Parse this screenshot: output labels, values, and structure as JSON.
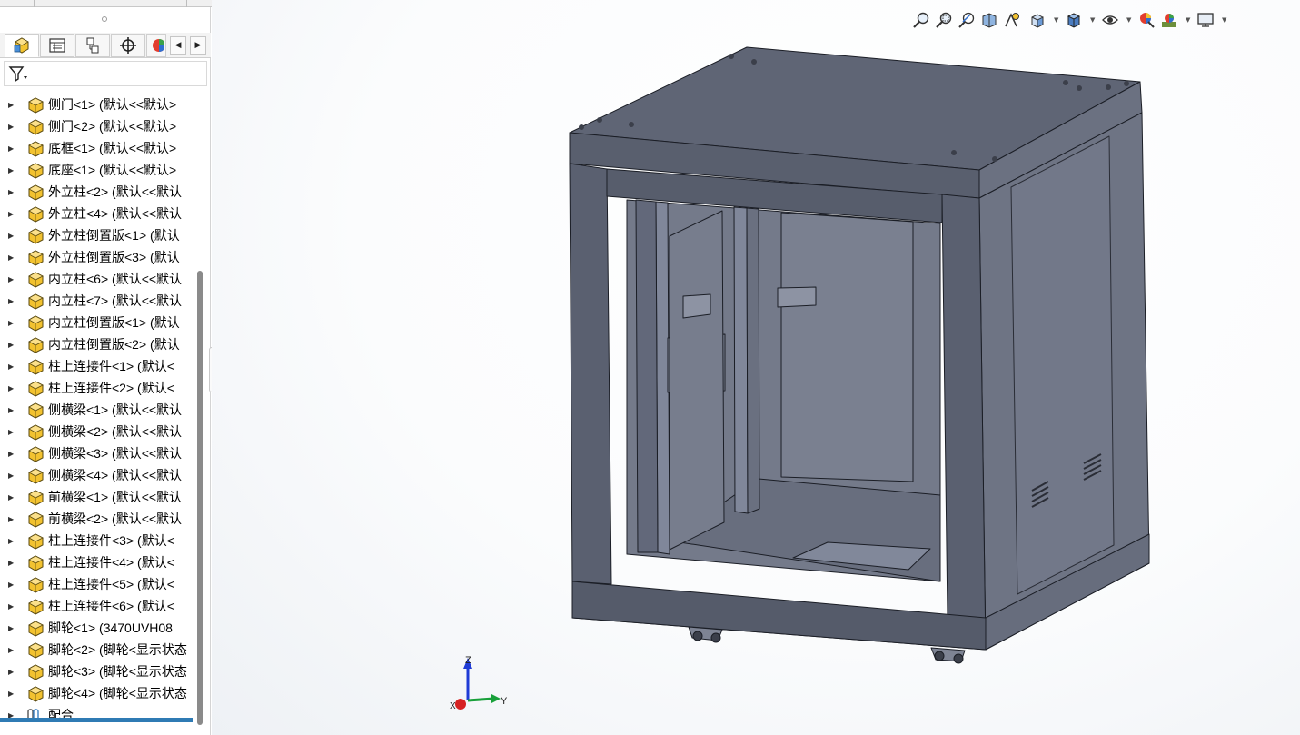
{
  "tabs": [
    {
      "name": "featuremanager-tab",
      "icon": "assembly-tree-icon"
    },
    {
      "name": "propertymanager-tab",
      "icon": "property-list-icon"
    },
    {
      "name": "configurationmanager-tab",
      "icon": "configuration-icon"
    },
    {
      "name": "dimxpert-tab",
      "icon": "crosshair-icon"
    },
    {
      "name": "display-manager-tab",
      "icon": "appearance-icon"
    }
  ],
  "tab_scroll": {
    "left": "◀",
    "right": "▶"
  },
  "filter": {
    "icon": "filter-icon",
    "dropdown": "▾"
  },
  "tree_items": [
    {
      "label": "侧门<1> (默认<<默认>",
      "type": "part"
    },
    {
      "label": "侧门<2> (默认<<默认>",
      "type": "part"
    },
    {
      "label": "底框<1> (默认<<默认>",
      "type": "part"
    },
    {
      "label": "底座<1> (默认<<默认>",
      "type": "part"
    },
    {
      "label": "外立柱<2> (默认<<默认",
      "type": "part"
    },
    {
      "label": "外立柱<4> (默认<<默认",
      "type": "part"
    },
    {
      "label": "外立柱倒置版<1> (默认",
      "type": "part"
    },
    {
      "label": "外立柱倒置版<3> (默认",
      "type": "part"
    },
    {
      "label": "内立柱<6> (默认<<默认",
      "type": "part"
    },
    {
      "label": "内立柱<7> (默认<<默认",
      "type": "part"
    },
    {
      "label": "内立柱倒置版<1> (默认",
      "type": "part"
    },
    {
      "label": "内立柱倒置版<2> (默认",
      "type": "part"
    },
    {
      "label": "柱上连接件<1> (默认<",
      "type": "part"
    },
    {
      "label": "柱上连接件<2> (默认<",
      "type": "part"
    },
    {
      "label": "侧横梁<1> (默认<<默认",
      "type": "part"
    },
    {
      "label": "侧横梁<2> (默认<<默认",
      "type": "part"
    },
    {
      "label": "侧横梁<3> (默认<<默认",
      "type": "part"
    },
    {
      "label": "侧横梁<4> (默认<<默认",
      "type": "part"
    },
    {
      "label": "前横梁<1> (默认<<默认",
      "type": "part"
    },
    {
      "label": "前横梁<2> (默认<<默认",
      "type": "part"
    },
    {
      "label": "柱上连接件<3> (默认<",
      "type": "part"
    },
    {
      "label": "柱上连接件<4> (默认<",
      "type": "part"
    },
    {
      "label": "柱上连接件<5> (默认<",
      "type": "part"
    },
    {
      "label": "柱上连接件<6> (默认<",
      "type": "part"
    },
    {
      "label": "脚轮<1> (3470UVH08",
      "type": "part"
    },
    {
      "label": "脚轮<2> (脚轮<显示状态",
      "type": "part"
    },
    {
      "label": "脚轮<3> (脚轮<显示状态",
      "type": "part"
    },
    {
      "label": "脚轮<4> (脚轮<显示状态",
      "type": "part"
    },
    {
      "label": "配合",
      "type": "mates"
    }
  ],
  "view_toolbar": [
    {
      "name": "zoom-to-fit-button",
      "icon": "zoom-fit-icon"
    },
    {
      "name": "zoom-to-area-button",
      "icon": "zoom-area-icon"
    },
    {
      "name": "previous-view-button",
      "icon": "previous-view-icon"
    },
    {
      "name": "section-view-button",
      "icon": "section-view-icon"
    },
    {
      "name": "dynamic-annotation-button",
      "icon": "annotation-icon"
    },
    {
      "name": "view-orientation-button",
      "icon": "view-orientation-icon",
      "dropdown": true
    },
    {
      "name": "display-style-button",
      "icon": "display-style-icon",
      "dropdown": true
    },
    {
      "name": "hide-show-items-button",
      "icon": "eye-icon",
      "dropdown": true
    },
    {
      "name": "edit-appearance-button",
      "icon": "appearance-icon"
    },
    {
      "name": "apply-scene-button",
      "icon": "scene-icon",
      "dropdown": true
    },
    {
      "name": "view-settings-button",
      "icon": "monitor-icon",
      "dropdown": true
    }
  ],
  "triad": {
    "z": "Z",
    "y": "Y",
    "x": "X"
  },
  "colors": {
    "accent": "#2f7bb4",
    "part_icon": "#f2c230",
    "model_front": "#5c6373",
    "model_top": "#5f6575",
    "model_side": "#6e7484"
  }
}
